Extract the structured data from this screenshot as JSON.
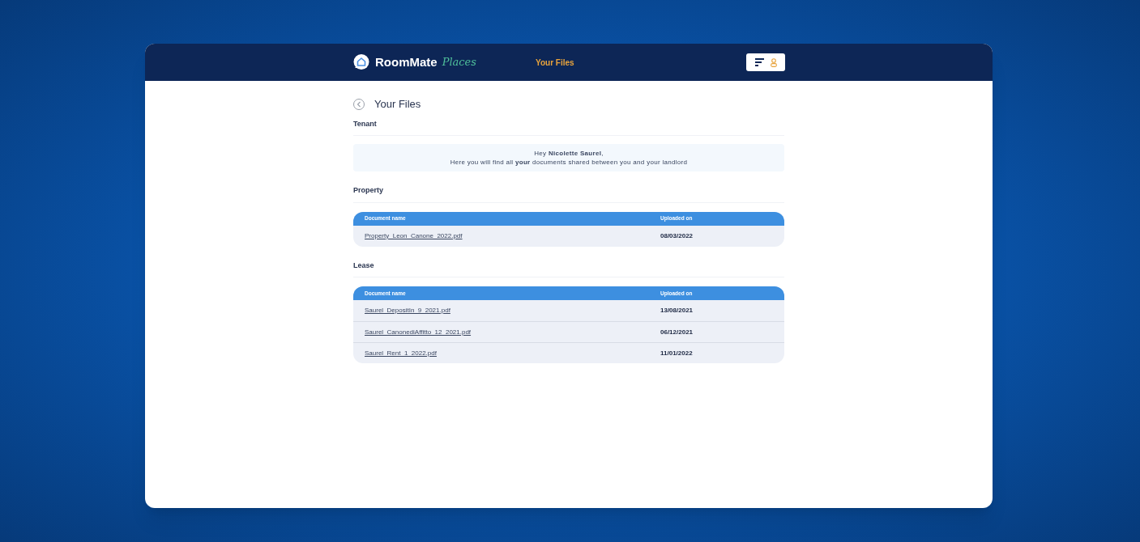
{
  "header": {
    "brand": "RoomMate",
    "brand_script": "Places",
    "nav_link": "Your Files"
  },
  "page": {
    "title": "Your Files",
    "section": "Tenant",
    "greeting": "Hey **Nicolette Saurel**,",
    "message": "Here you will find all **your** documents shared between you and your landlord"
  },
  "tables": [
    {
      "heading": "Property",
      "columns": [
        "Document name",
        "Uploaded on"
      ],
      "rows": [
        {
          "file": "Property_Leon_Canone_2022.pdf",
          "date": "08/03/2022"
        }
      ]
    },
    {
      "heading": "Lease",
      "columns": [
        "Document name",
        "Uploaded on"
      ],
      "rows": [
        {
          "file": "Saurel_DepositIn_9_2021.pdf",
          "date": "13/08/2021"
        },
        {
          "file": "Saurel_CanonediAffitto_12_2021.pdf",
          "date": "06/12/2021"
        },
        {
          "file": "Saurel_Rent_1_2022.pdf",
          "date": "11/01/2022"
        }
      ]
    }
  ]
}
